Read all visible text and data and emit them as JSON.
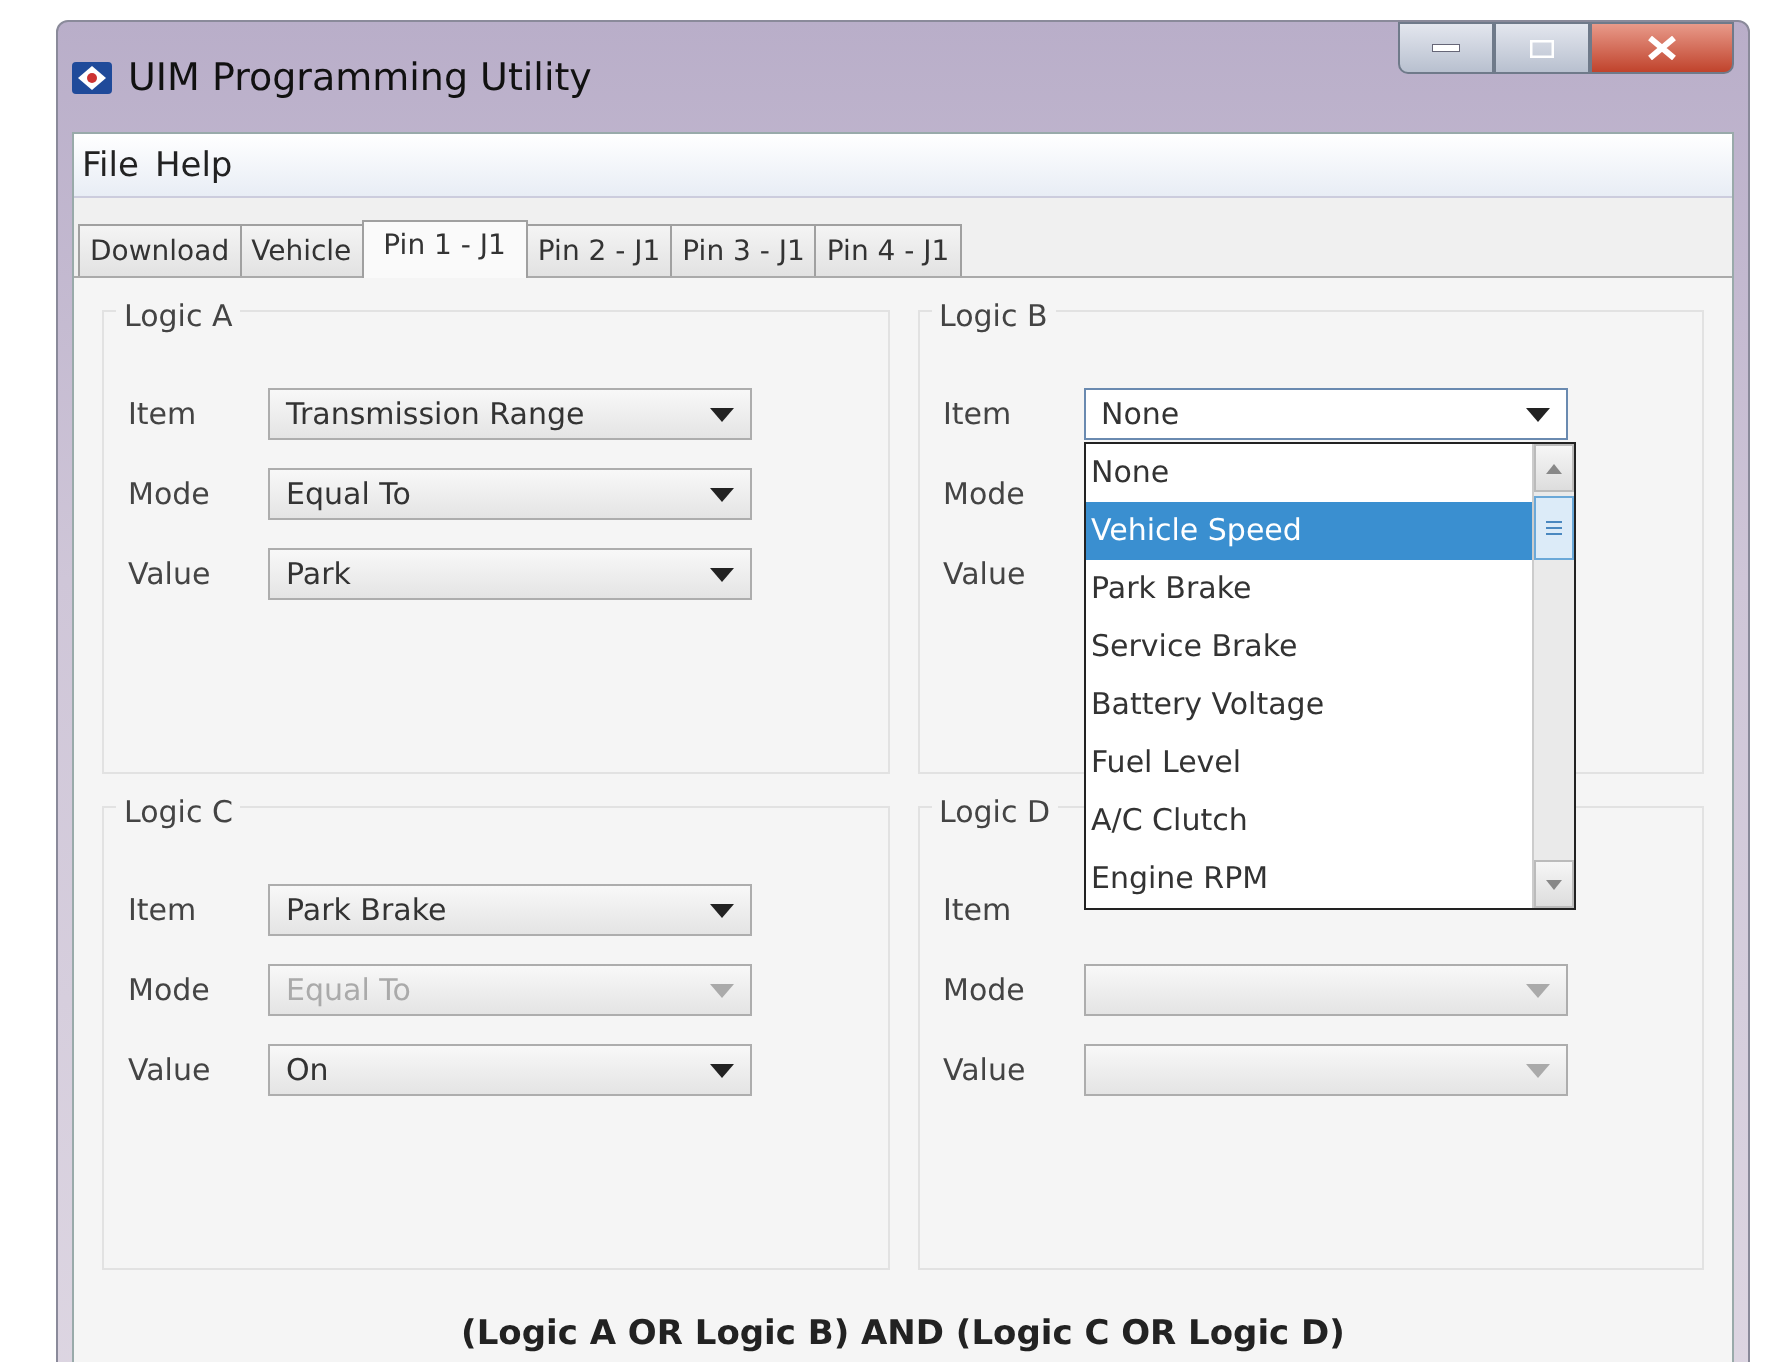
{
  "window": {
    "title": "UIM Programming Utility"
  },
  "menu": [
    "File",
    "Help"
  ],
  "tabs": [
    {
      "label": "Download",
      "selected": false
    },
    {
      "label": "Vehicle",
      "selected": false
    },
    {
      "label": "Pin 1 - J1",
      "selected": true
    },
    {
      "label": "Pin 2 - J1",
      "selected": false
    },
    {
      "label": "Pin 3 - J1",
      "selected": false
    },
    {
      "label": "Pin 4 - J1",
      "selected": false
    }
  ],
  "groups": [
    {
      "title": "Logic A",
      "fields": [
        {
          "label": "Item",
          "kind": "combo",
          "value": "Transmission Range",
          "disabled": false
        },
        {
          "label": "Mode",
          "kind": "combo",
          "value": "Equal To",
          "disabled": false
        },
        {
          "label": "Value",
          "kind": "combo",
          "value": "Park",
          "disabled": false
        }
      ]
    },
    {
      "title": "Logic B",
      "fields": [
        {
          "label": "Item",
          "kind": "combo",
          "value": "None",
          "disabled": false,
          "expanded": true,
          "options": [
            {
              "label": "None",
              "highlighted": false
            },
            {
              "label": "Vehicle Speed",
              "highlighted": true
            },
            {
              "label": "Park Brake",
              "highlighted": false
            },
            {
              "label": "Service Brake",
              "highlighted": false
            },
            {
              "label": "Battery Voltage",
              "highlighted": false
            },
            {
              "label": "Fuel Level",
              "highlighted": false
            },
            {
              "label": "A/C Clutch",
              "highlighted": false
            },
            {
              "label": "Engine RPM",
              "highlighted": false
            }
          ]
        },
        {
          "label": "Mode",
          "kind": "covered"
        },
        {
          "label": "Value",
          "kind": "covered"
        }
      ]
    },
    {
      "title": "Logic C",
      "fields": [
        {
          "label": "Item",
          "kind": "combo",
          "value": "Park Brake",
          "disabled": false
        },
        {
          "label": "Mode",
          "kind": "combo",
          "value": "Equal To",
          "disabled": true
        },
        {
          "label": "Value",
          "kind": "combo",
          "value": "On",
          "disabled": false
        }
      ]
    },
    {
      "title": "Logic D",
      "fields": [
        {
          "label": "Item",
          "kind": "covered"
        },
        {
          "label": "Mode",
          "kind": "combo",
          "disabled": true
        },
        {
          "label": "Value",
          "kind": "combo",
          "disabled": true
        }
      ]
    }
  ],
  "formula": "(Logic A OR Logic B) AND (Logic C OR Logic D)"
}
